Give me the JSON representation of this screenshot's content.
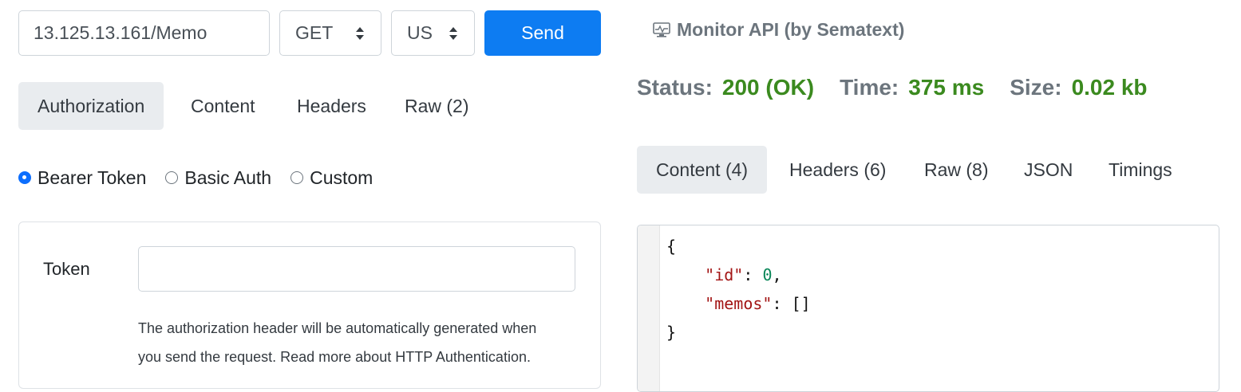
{
  "request": {
    "url": "13.125.13.161/Memo",
    "method": "GET",
    "region": "US",
    "send_label": "Send"
  },
  "left_tabs": [
    {
      "label": "Authorization",
      "active": true
    },
    {
      "label": "Content",
      "active": false
    },
    {
      "label": "Headers",
      "active": false
    },
    {
      "label": "Raw (2)",
      "active": false
    }
  ],
  "auth": {
    "options": [
      {
        "label": "Bearer Token",
        "selected": true
      },
      {
        "label": "Basic Auth",
        "selected": false
      },
      {
        "label": "Custom",
        "selected": false
      }
    ],
    "token_label": "Token",
    "token_value": "",
    "help_line1": "The authorization header will be automatically generated when",
    "help_line2": "you send the request. Read more about HTTP Authentication."
  },
  "monitor": {
    "label": "Monitor API (by Sematext)",
    "icon": "monitor-icon"
  },
  "response": {
    "status_label": "Status:",
    "status_value": "200 (OK)",
    "time_label": "Time:",
    "time_value": "375 ms",
    "size_label": "Size:",
    "size_value": "0.02 kb",
    "value_color": "#3b8a1f"
  },
  "right_tabs": [
    {
      "label": "Content (4)",
      "active": true
    },
    {
      "label": "Headers (6)",
      "active": false
    },
    {
      "label": "Raw (8)",
      "active": false
    },
    {
      "label": "JSON",
      "active": false
    },
    {
      "label": "Timings",
      "active": false
    }
  ],
  "body_json": {
    "open": "{",
    "line1_key": "\"id\"",
    "line1_sep": ": ",
    "line1_val": "0",
    "line1_end": ",",
    "line2_key": "\"memos\"",
    "line2_sep": ": ",
    "line2_val": "[]",
    "close": "}"
  },
  "colors": {
    "accent": "#0d7cf2",
    "success": "#3b8a1f",
    "muted": "#6c757d"
  }
}
